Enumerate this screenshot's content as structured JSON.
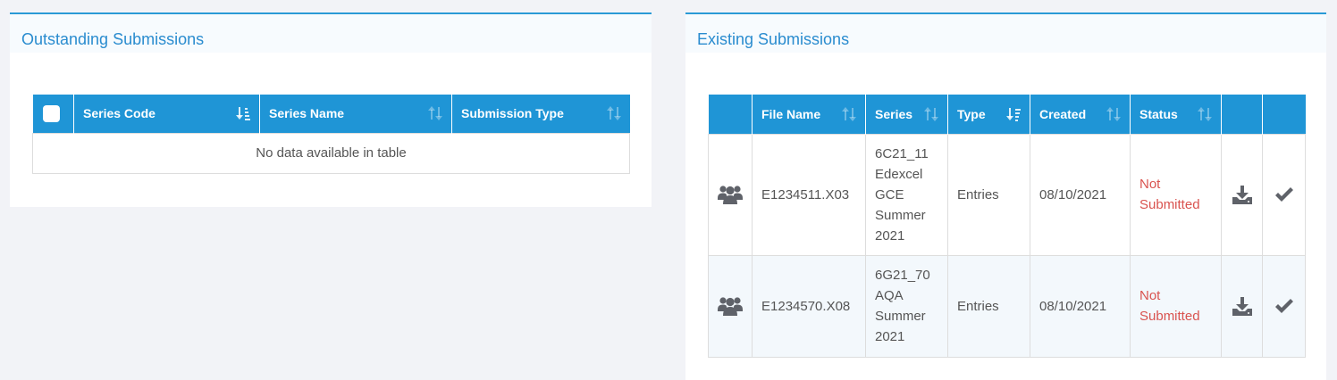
{
  "outstanding": {
    "title": "Outstanding Submissions",
    "columns": [
      "Series Code",
      "Series Name",
      "Submission Type"
    ],
    "empty_text": "No data available in table"
  },
  "existing": {
    "title": "Existing Submissions",
    "columns": [
      "File Name",
      "Series",
      "Type",
      "Created",
      "Status"
    ],
    "rows": [
      {
        "file_name": "E1234511.X03",
        "series_lines": [
          "6C21_11",
          "Edexcel",
          "GCE",
          "Summer",
          "2021"
        ],
        "type": "Entries",
        "created": "08/10/2021",
        "status_lines": [
          "Not",
          "Submitted"
        ]
      },
      {
        "file_name": "E1234570.X08",
        "series_lines": [
          "6G21_70",
          "AQA",
          "Summer",
          "2021"
        ],
        "type": "Entries",
        "created": "08/10/2021",
        "status_lines": [
          "Not",
          "Submitted"
        ]
      }
    ]
  },
  "icons": {
    "sort_active": "sort-amount-down-icon",
    "sort_both": "sort-both-icon",
    "group": "users-icon",
    "download": "download-icon",
    "check": "check-icon"
  },
  "colors": {
    "accent": "#1f95d6",
    "title": "#2a8ccf",
    "status_not_submitted": "#d9534f",
    "icon_gray": "#5f6269"
  }
}
